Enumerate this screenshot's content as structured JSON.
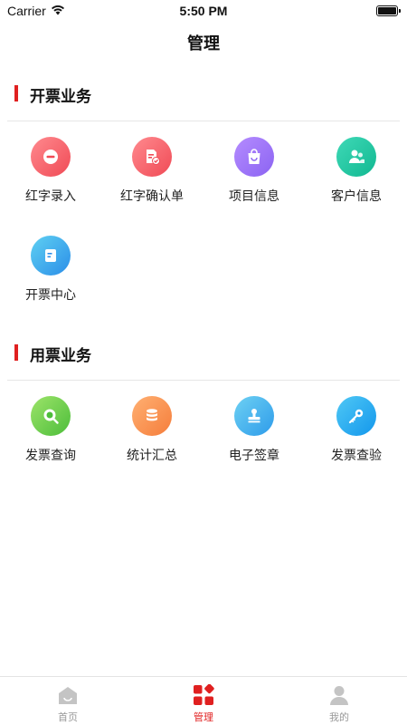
{
  "status_bar": {
    "carrier": "Carrier",
    "time": "5:50 PM"
  },
  "nav": {
    "title": "管理"
  },
  "sections": [
    {
      "title": "开票业务",
      "items": [
        {
          "label": "红字录入",
          "icon": "minus-circle-icon",
          "color_from": "#ff8a8f",
          "color_to": "#f04a55"
        },
        {
          "label": "红字确认单",
          "icon": "document-check-icon",
          "color_from": "#ff8a8f",
          "color_to": "#f04a55"
        },
        {
          "label": "项目信息",
          "icon": "shopping-bag-icon",
          "color_from": "#b58cff",
          "color_to": "#8b63f2"
        },
        {
          "label": "客户信息",
          "icon": "contacts-icon",
          "color_from": "#3fd9b7",
          "color_to": "#11b891"
        },
        {
          "label": "开票中心",
          "icon": "invoice-icon",
          "color_from": "#5fd0f2",
          "color_to": "#2b8ee8"
        }
      ]
    },
    {
      "title": "用票业务",
      "items": [
        {
          "label": "发票查询",
          "icon": "search-icon",
          "color_from": "#9de46a",
          "color_to": "#4cbd3a"
        },
        {
          "label": "统计汇总",
          "icon": "database-icon",
          "color_from": "#ffb072",
          "color_to": "#f57d3b"
        },
        {
          "label": "电子签章",
          "icon": "stamp-icon",
          "color_from": "#6ed1f3",
          "color_to": "#2d9bea"
        },
        {
          "label": "发票查验",
          "icon": "key-icon",
          "color_from": "#4fc8f5",
          "color_to": "#1397ec"
        }
      ]
    }
  ],
  "tab_bar": {
    "tabs": [
      {
        "label": "首页",
        "icon": "home-icon",
        "active": false
      },
      {
        "label": "管理",
        "icon": "grid-icon",
        "active": true
      },
      {
        "label": "我的",
        "icon": "user-icon",
        "active": false
      }
    ]
  },
  "colors": {
    "accent": "#e02020",
    "inactive": "#999999"
  }
}
